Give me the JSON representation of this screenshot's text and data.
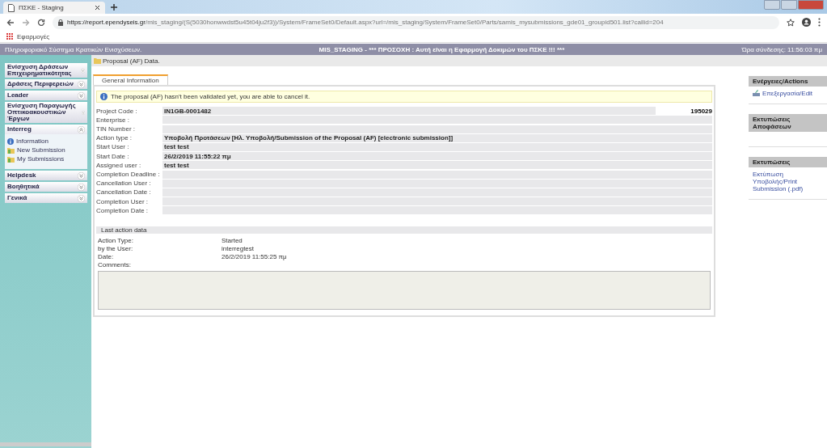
{
  "browser": {
    "tab_title": "ΠΣΚΕ - Staging",
    "url_host": "https://report.ependyseis.gr",
    "url_path": "/mis_staging/(S(5030honwwdst5u45t04ju2f3))/System/FrameSet0/Default.aspx?url=/mis_staging/System/FrameSet0/Parts/samis_mysubmissions_gde01_groupid501.list?callid=204",
    "bookmark": "Εφαρμογές"
  },
  "header": {
    "system": "Πληροφοριακό Σύστημα Κρατικών Ενισχύσεων.",
    "warning": "MIS_STAGING - *** ΠΡΟΣΟΧΗ : Αυτή είναι η Εφαρμογή Δοκιμών του ΠΣΚΕ !!! ***",
    "login_time": "Ώρα σύνδεσης: 11:56:03 πμ"
  },
  "page_title": "Proposal (AF) Data.",
  "sidebar": [
    {
      "label": "Ενίσχυση Δράσεων Επιχειρηματικότητας",
      "expanded": false
    },
    {
      "label": "Δράσεις Περιφερειών",
      "expanded": false
    },
    {
      "label": "Leader",
      "expanded": false
    },
    {
      "label": "Ενίσχυση Παραγωγής Οπτικοακουστικών Έργων",
      "expanded": false
    },
    {
      "label": "Interreg",
      "expanded": true,
      "children": [
        {
          "label": "Information",
          "kind": "info"
        },
        {
          "label": "New Submission",
          "kind": "folder"
        },
        {
          "label": "My Submissions",
          "kind": "folder"
        }
      ]
    },
    {
      "label": "Helpdesk",
      "expanded": false
    },
    {
      "label": "Βοηθητικά",
      "expanded": false
    },
    {
      "label": "Γενικά",
      "expanded": false
    }
  ],
  "tabs": [
    {
      "label": "General Information",
      "selected": true
    }
  ],
  "notice": "The proposal (AF) hasn't been validated yet, you are able to cancel it.",
  "fields": [
    {
      "label": "Project Code :",
      "value": "IN1GB-0001482",
      "extra": "195029"
    },
    {
      "label": "Enterprise :"
    },
    {
      "label": "TIN Number :"
    },
    {
      "label": "Action type :",
      "value": "Υποβολή Προτάσεων [Ηλ. Υποβολή/Submission of the Proposal (AF) [electronic submission]]"
    },
    {
      "label": "Start User :",
      "value": "test test"
    },
    {
      "label": "Start Date :",
      "value": "26/2/2019 11:55:22 πμ"
    },
    {
      "label": "Assigned user :",
      "value": "test test"
    },
    {
      "label": "Completion Deadline :"
    },
    {
      "label": "Cancellation User :"
    },
    {
      "label": "Cancellation Date :"
    },
    {
      "label": "Completion User :"
    },
    {
      "label": "Completion Date :"
    }
  ],
  "last_action": {
    "title": "Last action data",
    "rows": [
      {
        "label": "Action Type:",
        "value": "Started"
      },
      {
        "label": "by the User:",
        "value": "interregtest"
      },
      {
        "label": "Date:",
        "value": "26/2/2019 11:55:25 πμ"
      }
    ],
    "comments_label": "Comments:"
  },
  "right_panels": [
    {
      "title": "Ενέργειες/Actions",
      "links": [
        {
          "label": "Επεξεργασία/Edit",
          "kind": "edit"
        }
      ]
    },
    {
      "title": "Εκτυπώσεις Αποφάσεων"
    },
    {
      "title": "Εκτυπώσεις",
      "links": [
        {
          "label": "Εκτύπωση Υποβολής/Print Submission (.pdf)",
          "kind": "plain"
        }
      ]
    }
  ]
}
